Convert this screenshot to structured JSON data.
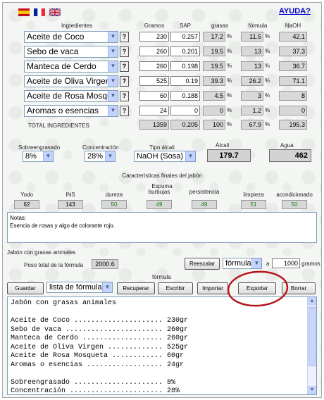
{
  "header": {
    "help_link": "AYUDA?"
  },
  "columns": {
    "ingredients": "Ingredientes",
    "grams": "Gramos",
    "sap": "SAP",
    "fats": "grasas",
    "formula": "fórmula",
    "naoh": "NaOH"
  },
  "rows": [
    {
      "name": "Aceite de Coco",
      "grams": "230",
      "sap": "0.257",
      "fats": "17.2",
      "formula": "11.5",
      "naoh": "42.1"
    },
    {
      "name": "Sebo de vaca",
      "grams": "260",
      "sap": "0.201",
      "fats": "19.5",
      "formula": "13",
      "naoh": "37.3"
    },
    {
      "name": "Manteca de Cerdo",
      "grams": "260",
      "sap": "0.198",
      "fats": "19.5",
      "formula": "13",
      "naoh": "36.7"
    },
    {
      "name": "Aceite de Oliva Virgen",
      "grams": "525",
      "sap": "0.19",
      "fats": "39.3",
      "formula": "26.2",
      "naoh": "71.1"
    },
    {
      "name": "Aceite de Rosa Mosquet",
      "grams": "60",
      "sap": "0.188",
      "fats": "4.5",
      "formula": "3",
      "naoh": "8"
    },
    {
      "name": "Aromas o esencias",
      "grams": "24",
      "sap": "0",
      "fats": "0",
      "formula": "1.2",
      "naoh": "0"
    }
  ],
  "help_button": "?",
  "percent_sign": "%",
  "totals": {
    "label": "TOTAL INGREDIENTES",
    "grams": "1359",
    "sap": "0.205",
    "fats": "100",
    "formula": "67.9",
    "naoh": "195.3"
  },
  "settings": {
    "superfat_label": "Sobreengrasado",
    "superfat_value": "8%",
    "concentration_label": "Concentración",
    "concentration_value": "28%",
    "alkali_type_label": "Tipo álcali",
    "alkali_type_value": "NaOH (Sosa)",
    "alkali_label": "Álcali",
    "alkali_value": "179.7",
    "water_label": "Agua",
    "water_value": "462"
  },
  "properties": {
    "title": "Características finales del jabón",
    "foam_label": "Espuma",
    "items": [
      {
        "label": "Yodo",
        "value": "62",
        "green": false
      },
      {
        "label": "INS",
        "value": "143",
        "green": false
      },
      {
        "label": "dureza",
        "value": "50",
        "green": true
      },
      {
        "label": "burbujas",
        "value": "49",
        "green": true
      },
      {
        "label": "persistencia",
        "value": "49",
        "green": true
      },
      {
        "label": "limpieza",
        "value": "51",
        "green": true
      },
      {
        "label": "acondicionado",
        "value": "50",
        "green": true
      }
    ]
  },
  "notes": {
    "label": "Notas:",
    "text": "Esencia de rosas y algo de colorante rojo."
  },
  "formula": {
    "name": "Jabón con grasas animales",
    "total_label": "Peso total de la fórmula",
    "total_value": "2000.6",
    "rescale_button": "Reescalar",
    "rescale_select": "fórmula",
    "to_label": "a",
    "target_value": "1000",
    "grams_label": "gramos",
    "section_label": "fórmula"
  },
  "actions": {
    "save": "Guardar",
    "formula_list": "lista de fórmulas",
    "recover": "Recuperar",
    "write": "Escribir",
    "import": "Importar",
    "export": "Exportar",
    "delete": "Borrar"
  },
  "output_lines": [
    "Jabón con grasas animales",
    "",
    "Aceite de Coco ..................... 230gr",
    "Sebo de vaca ....................... 260gr",
    "Manteca de Cerdo ................... 260gr",
    "Aceite de Oliva Virgen ............. 525gr",
    "Aceite de Rosa Mosqueta ............ 60gr",
    "Aromas o esencias .................. 24gr",
    "",
    "Sobreengrasado ..................... 8%",
    "Concentración ...................... 28%"
  ],
  "colors": {
    "highlight_circle": "#b3151b",
    "link": "#0000cc",
    "green_value": "#1a7a1a"
  }
}
